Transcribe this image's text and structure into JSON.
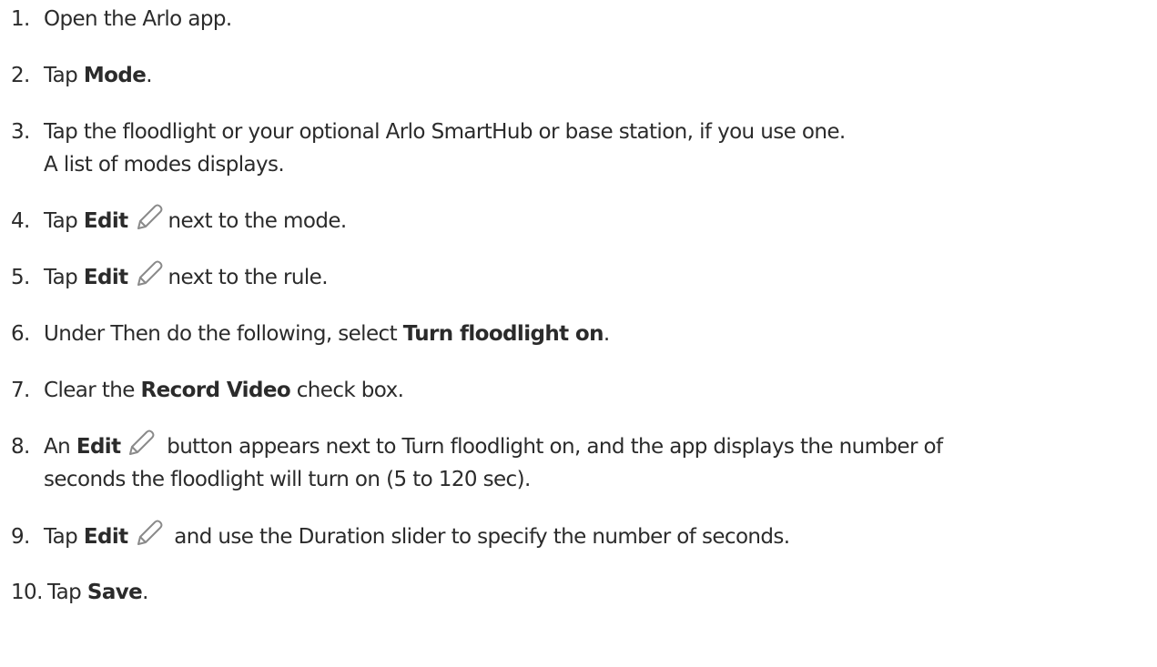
{
  "steps": [
    {
      "num": "1.",
      "text": "Open the Arlo app."
    },
    {
      "num": "2.",
      "pre": "Tap ",
      "bold": "Mode",
      "post": "."
    },
    {
      "num": "3.",
      "text": "Tap the floodlight or your optional Arlo SmartHub or base station, if you use one.",
      "line2": "A list of modes displays."
    },
    {
      "num": "4.",
      "pre": "Tap ",
      "bold": "Edit",
      "icon": "pencil-icon",
      "post": "next to the mode."
    },
    {
      "num": "5.",
      "pre": "Tap ",
      "bold": "Edit",
      "icon": "pencil-icon",
      "post": "next to the rule."
    },
    {
      "num": "6.",
      "pre": "Under Then do the following, select ",
      "bold": "Turn floodlight on",
      "post": "."
    },
    {
      "num": "7.",
      "pre": "Clear the ",
      "bold": "Record Video",
      "post": " check box."
    },
    {
      "num": "8.",
      "pre": "An ",
      "bold": "Edit",
      "icon": "pencil-icon",
      "post": " button appears next to Turn floodlight on, and the app displays the number of",
      "line2": "seconds the floodlight will turn on (5 to 120 sec)."
    },
    {
      "num": "9.",
      "pre": "Tap ",
      "bold": "Edit",
      "icon": "pencil-icon",
      "post": " and use the Duration slider to specify the number of seconds."
    },
    {
      "num": "10.",
      "pre": "Tap ",
      "bold": "Save",
      "post": "."
    }
  ],
  "colors": {
    "text": "#2b2b2b",
    "icon": "#8a8a8a"
  }
}
